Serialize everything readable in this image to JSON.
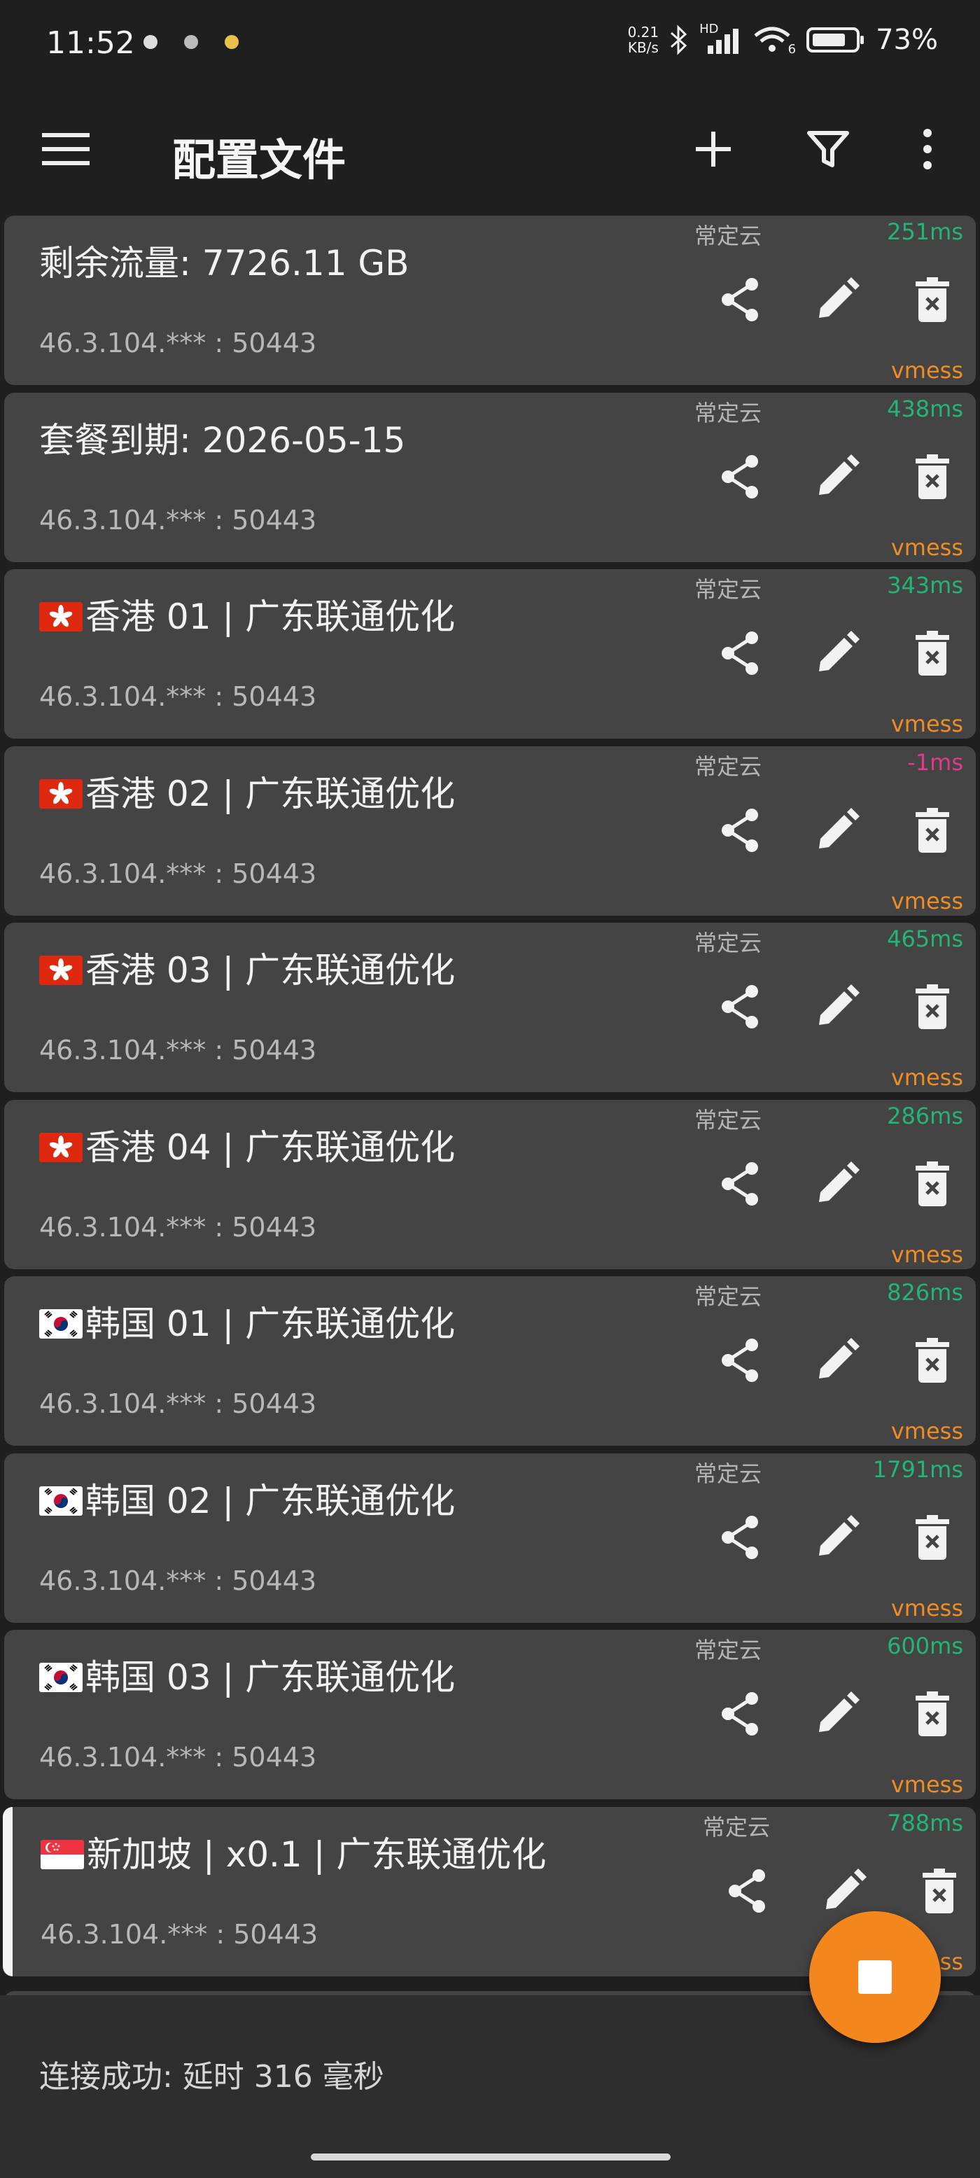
{
  "status_bar": {
    "time": "11:52",
    "net_speed_value": "0.21",
    "net_speed_unit": "KB/s",
    "signal_label": "HD",
    "wifi_label": "6",
    "battery": "73%"
  },
  "app_bar": {
    "title": "配置文件",
    "actions": [
      "add-icon",
      "filter-icon",
      "more-vert-icon"
    ]
  },
  "profiles": [
    {
      "name": "剩余流量: 7726.11 GB",
      "flag": "",
      "address": "46.3.104.*** : 50443",
      "subscription": "常定云",
      "latency": "251ms",
      "latency_status": "ok",
      "protocol": "vmess",
      "selected": false
    },
    {
      "name": "套餐到期: 2026-05-15",
      "flag": "",
      "address": "46.3.104.*** : 50443",
      "subscription": "常定云",
      "latency": "438ms",
      "latency_status": "ok",
      "protocol": "vmess",
      "selected": false
    },
    {
      "name": "香港 01 | 广东联通优化",
      "flag": "hk",
      "address": "46.3.104.*** : 50443",
      "subscription": "常定云",
      "latency": "343ms",
      "latency_status": "ok",
      "protocol": "vmess",
      "selected": false
    },
    {
      "name": "香港 02 | 广东联通优化",
      "flag": "hk",
      "address": "46.3.104.*** : 50443",
      "subscription": "常定云",
      "latency": "-1ms",
      "latency_status": "fail",
      "protocol": "vmess",
      "selected": false
    },
    {
      "name": "香港 03 | 广东联通优化",
      "flag": "hk",
      "address": "46.3.104.*** : 50443",
      "subscription": "常定云",
      "latency": "465ms",
      "latency_status": "ok",
      "protocol": "vmess",
      "selected": false
    },
    {
      "name": "香港 04 | 广东联通优化",
      "flag": "hk",
      "address": "46.3.104.*** : 50443",
      "subscription": "常定云",
      "latency": "286ms",
      "latency_status": "ok",
      "protocol": "vmess",
      "selected": false
    },
    {
      "name": "韩国 01 | 广东联通优化",
      "flag": "kr",
      "address": "46.3.104.*** : 50443",
      "subscription": "常定云",
      "latency": "826ms",
      "latency_status": "ok",
      "protocol": "vmess",
      "selected": false
    },
    {
      "name": "韩国 02 | 广东联通优化",
      "flag": "kr",
      "address": "46.3.104.*** : 50443",
      "subscription": "常定云",
      "latency": "1791ms",
      "latency_status": "ok",
      "protocol": "vmess",
      "selected": false
    },
    {
      "name": "韩国 03 | 广东联通优化",
      "flag": "kr",
      "address": "46.3.104.*** : 50443",
      "subscription": "常定云",
      "latency": "600ms",
      "latency_status": "ok",
      "protocol": "vmess",
      "selected": false
    },
    {
      "name": "新加坡 | x0.1 | 广东联通优化",
      "flag": "sg",
      "address": "46.3.104.*** : 50443",
      "subscription": "常定云",
      "latency": "788ms",
      "latency_status": "ok",
      "protocol": "vmess",
      "selected": true
    }
  ],
  "card_actions": [
    "share-icon",
    "edit-icon",
    "delete-icon"
  ],
  "bottom_status": "连接成功: 延时 316 毫秒",
  "fab": {
    "icon": "stop-icon"
  },
  "colors": {
    "background": "#1f1f1f",
    "card": "#444444",
    "latency_ok": "#23b577",
    "latency_fail": "#e03a8a",
    "protocol": "#f08c24",
    "fab": "#f3861c"
  }
}
